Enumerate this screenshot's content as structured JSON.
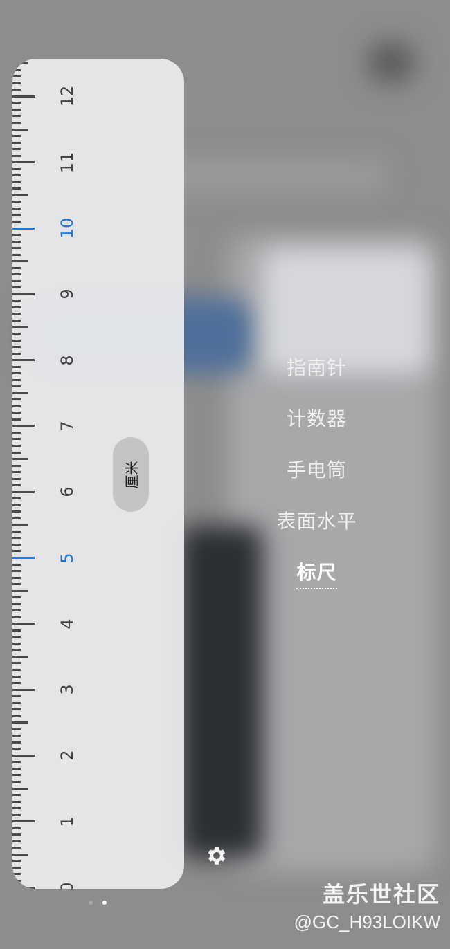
{
  "ruler": {
    "unit_label": "厘米",
    "visible_numbers": [
      "0",
      "1",
      "2",
      "3",
      "4",
      "5",
      "6",
      "7",
      "8",
      "9",
      "10",
      "11",
      "12"
    ],
    "highlighted_numbers": [
      "5",
      "10"
    ],
    "accent_color": "#1e7ae0"
  },
  "tools_menu": {
    "items": [
      {
        "label": "指南针"
      },
      {
        "label": "计数器"
      },
      {
        "label": "手电筒"
      },
      {
        "label": "表面水平"
      },
      {
        "label": "标尺",
        "selected": true
      }
    ]
  },
  "settings": {
    "icon": "gear-icon"
  },
  "page_indicator": {
    "count": 2,
    "active": 2
  },
  "watermark": {
    "title": "盖乐世社区",
    "handle": "@GC_H93LOIKW"
  }
}
